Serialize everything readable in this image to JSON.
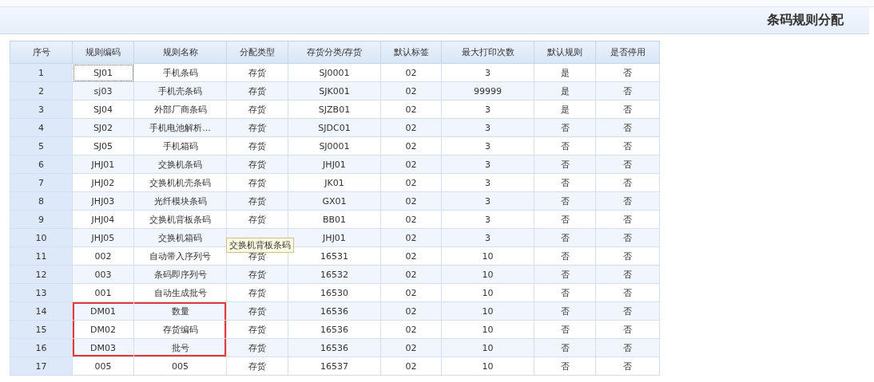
{
  "window": {
    "title": "条码规则分配"
  },
  "table": {
    "columns": [
      "序号",
      "规则编码",
      "规则名称",
      "分配类型",
      "存货分类/存货",
      "默认标签",
      "最大打印次数",
      "默认规则",
      "是否停用"
    ],
    "rows": [
      {
        "no": "1",
        "code": "SJ01",
        "name": "手机条码",
        "type": "存货",
        "category": "SJ0001",
        "label": "02",
        "max_prints": "3",
        "default_rule": "是",
        "disabled": "否",
        "focused": true,
        "highlighted": false
      },
      {
        "no": "2",
        "code": "sj03",
        "name": "手机壳条码",
        "type": "存货",
        "category": "SJK001",
        "label": "02",
        "max_prints": "99999",
        "default_rule": "是",
        "disabled": "否",
        "focused": false,
        "highlighted": false
      },
      {
        "no": "3",
        "code": "SJ04",
        "name": "外部厂商条码",
        "type": "存货",
        "category": "SJZB01",
        "label": "02",
        "max_prints": "3",
        "default_rule": "是",
        "disabled": "否",
        "focused": false,
        "highlighted": false
      },
      {
        "no": "4",
        "code": "SJ02",
        "name": "手机电池解析...",
        "type": "存货",
        "category": "SJDC01",
        "label": "02",
        "max_prints": "3",
        "default_rule": "否",
        "disabled": "否",
        "focused": false,
        "highlighted": false
      },
      {
        "no": "5",
        "code": "SJ05",
        "name": "手机箱码",
        "type": "存货",
        "category": "SJ0001",
        "label": "02",
        "max_prints": "3",
        "default_rule": "否",
        "disabled": "否",
        "focused": false,
        "highlighted": false
      },
      {
        "no": "6",
        "code": "JHJ01",
        "name": "交换机条码",
        "type": "存货",
        "category": "JHJ01",
        "label": "02",
        "max_prints": "3",
        "default_rule": "否",
        "disabled": "否",
        "focused": false,
        "highlighted": false
      },
      {
        "no": "7",
        "code": "JHJ02",
        "name": "交换机机壳条码",
        "type": "存货",
        "category": "JK01",
        "label": "02",
        "max_prints": "3",
        "default_rule": "否",
        "disabled": "否",
        "focused": false,
        "highlighted": false
      },
      {
        "no": "8",
        "code": "JHJ03",
        "name": "光纤模块条码",
        "type": "存货",
        "category": "GX01",
        "label": "02",
        "max_prints": "3",
        "default_rule": "否",
        "disabled": "否",
        "focused": false,
        "highlighted": false
      },
      {
        "no": "9",
        "code": "JHJ04",
        "name": "交换机背板条码",
        "type": "存货",
        "category": "BB01",
        "label": "02",
        "max_prints": "3",
        "default_rule": "否",
        "disabled": "否",
        "focused": false,
        "highlighted": false
      },
      {
        "no": "10",
        "code": "JHJ05",
        "name": "交换机箱码",
        "category": "JHJ01",
        "label": "02",
        "max_prints": "3",
        "default_rule": "否",
        "disabled": "否",
        "focused": false,
        "highlighted": false
      },
      {
        "no": "11",
        "code": "002",
        "name": "自动带入序列号",
        "type": "存货",
        "category": "16531",
        "label": "02",
        "max_prints": "10",
        "default_rule": "否",
        "disabled": "否",
        "focused": false,
        "highlighted": false
      },
      {
        "no": "12",
        "code": "003",
        "name": "条码即序列号",
        "type": "存货",
        "category": "16532",
        "label": "02",
        "max_prints": "10",
        "default_rule": "否",
        "disabled": "否",
        "focused": false,
        "highlighted": false
      },
      {
        "no": "13",
        "code": "001",
        "name": "自动生成批号",
        "type": "存货",
        "category": "16530",
        "label": "02",
        "max_prints": "10",
        "default_rule": "否",
        "disabled": "否",
        "focused": false,
        "highlighted": false
      },
      {
        "no": "14",
        "code": "DM01",
        "name": "数量",
        "type": "存货",
        "category": "16536",
        "label": "02",
        "max_prints": "10",
        "default_rule": "否",
        "disabled": "否",
        "focused": false,
        "highlighted": true
      },
      {
        "no": "15",
        "code": "DM02",
        "name": "存货编码",
        "type": "存货",
        "category": "16536",
        "label": "02",
        "max_prints": "10",
        "default_rule": "否",
        "disabled": "否",
        "focused": false,
        "highlighted": true
      },
      {
        "no": "16",
        "code": "DM03",
        "name": "批号",
        "type": "存货",
        "category": "16536",
        "label": "02",
        "max_prints": "10",
        "default_rule": "否",
        "disabled": "否",
        "focused": false,
        "highlighted": true
      },
      {
        "no": "17",
        "code": "005",
        "name": "005",
        "type": "存货",
        "category": "16537",
        "label": "02",
        "max_prints": "10",
        "default_rule": "否",
        "disabled": "否",
        "focused": false,
        "highlighted": false
      }
    ]
  },
  "tooltip": {
    "text": "交换机背板条码"
  }
}
